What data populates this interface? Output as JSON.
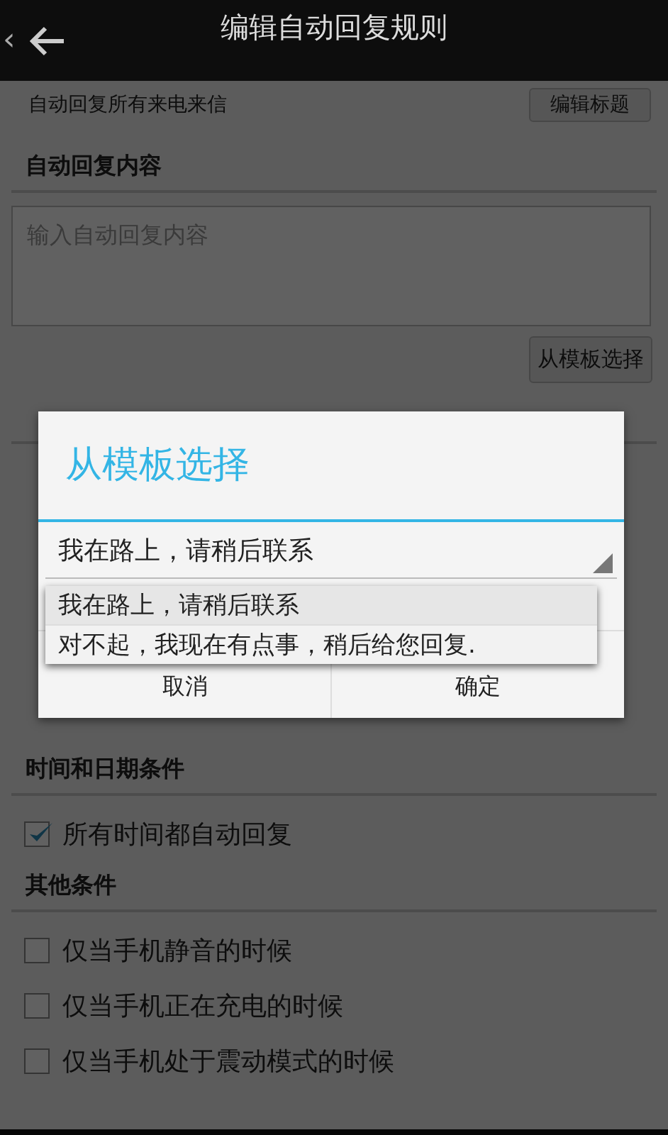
{
  "app_bar": {
    "back_chevron": "‹",
    "title": "编辑自动回复规则"
  },
  "rule_title": {
    "text": "自动回复所有来电来信",
    "button": "编辑标题"
  },
  "content_section": {
    "title": "自动回复内容",
    "placeholder": "输入自动回复内容",
    "template_button": "从模板选择"
  },
  "time_section": {
    "title": "时间和日期条件",
    "options": [
      {
        "label": "所有时间都自动回复",
        "checked": true
      }
    ]
  },
  "other_section": {
    "title": "其他条件",
    "options": [
      {
        "label": "仅当手机静音的时候",
        "checked": false
      },
      {
        "label": "仅当手机正在充电的时候",
        "checked": false
      },
      {
        "label": "仅当手机处于震动模式的时候",
        "checked": false
      }
    ]
  },
  "dialog": {
    "title": "从模板选择",
    "spinner_value": "我在路上，请稍后联系",
    "dropdown": [
      {
        "label": "我在路上，请稍后联系",
        "selected": true
      },
      {
        "label": "对不起，我现在有点事，稍后给您回复.",
        "selected": false
      }
    ],
    "buttons": [
      "取消",
      "确定"
    ]
  }
}
